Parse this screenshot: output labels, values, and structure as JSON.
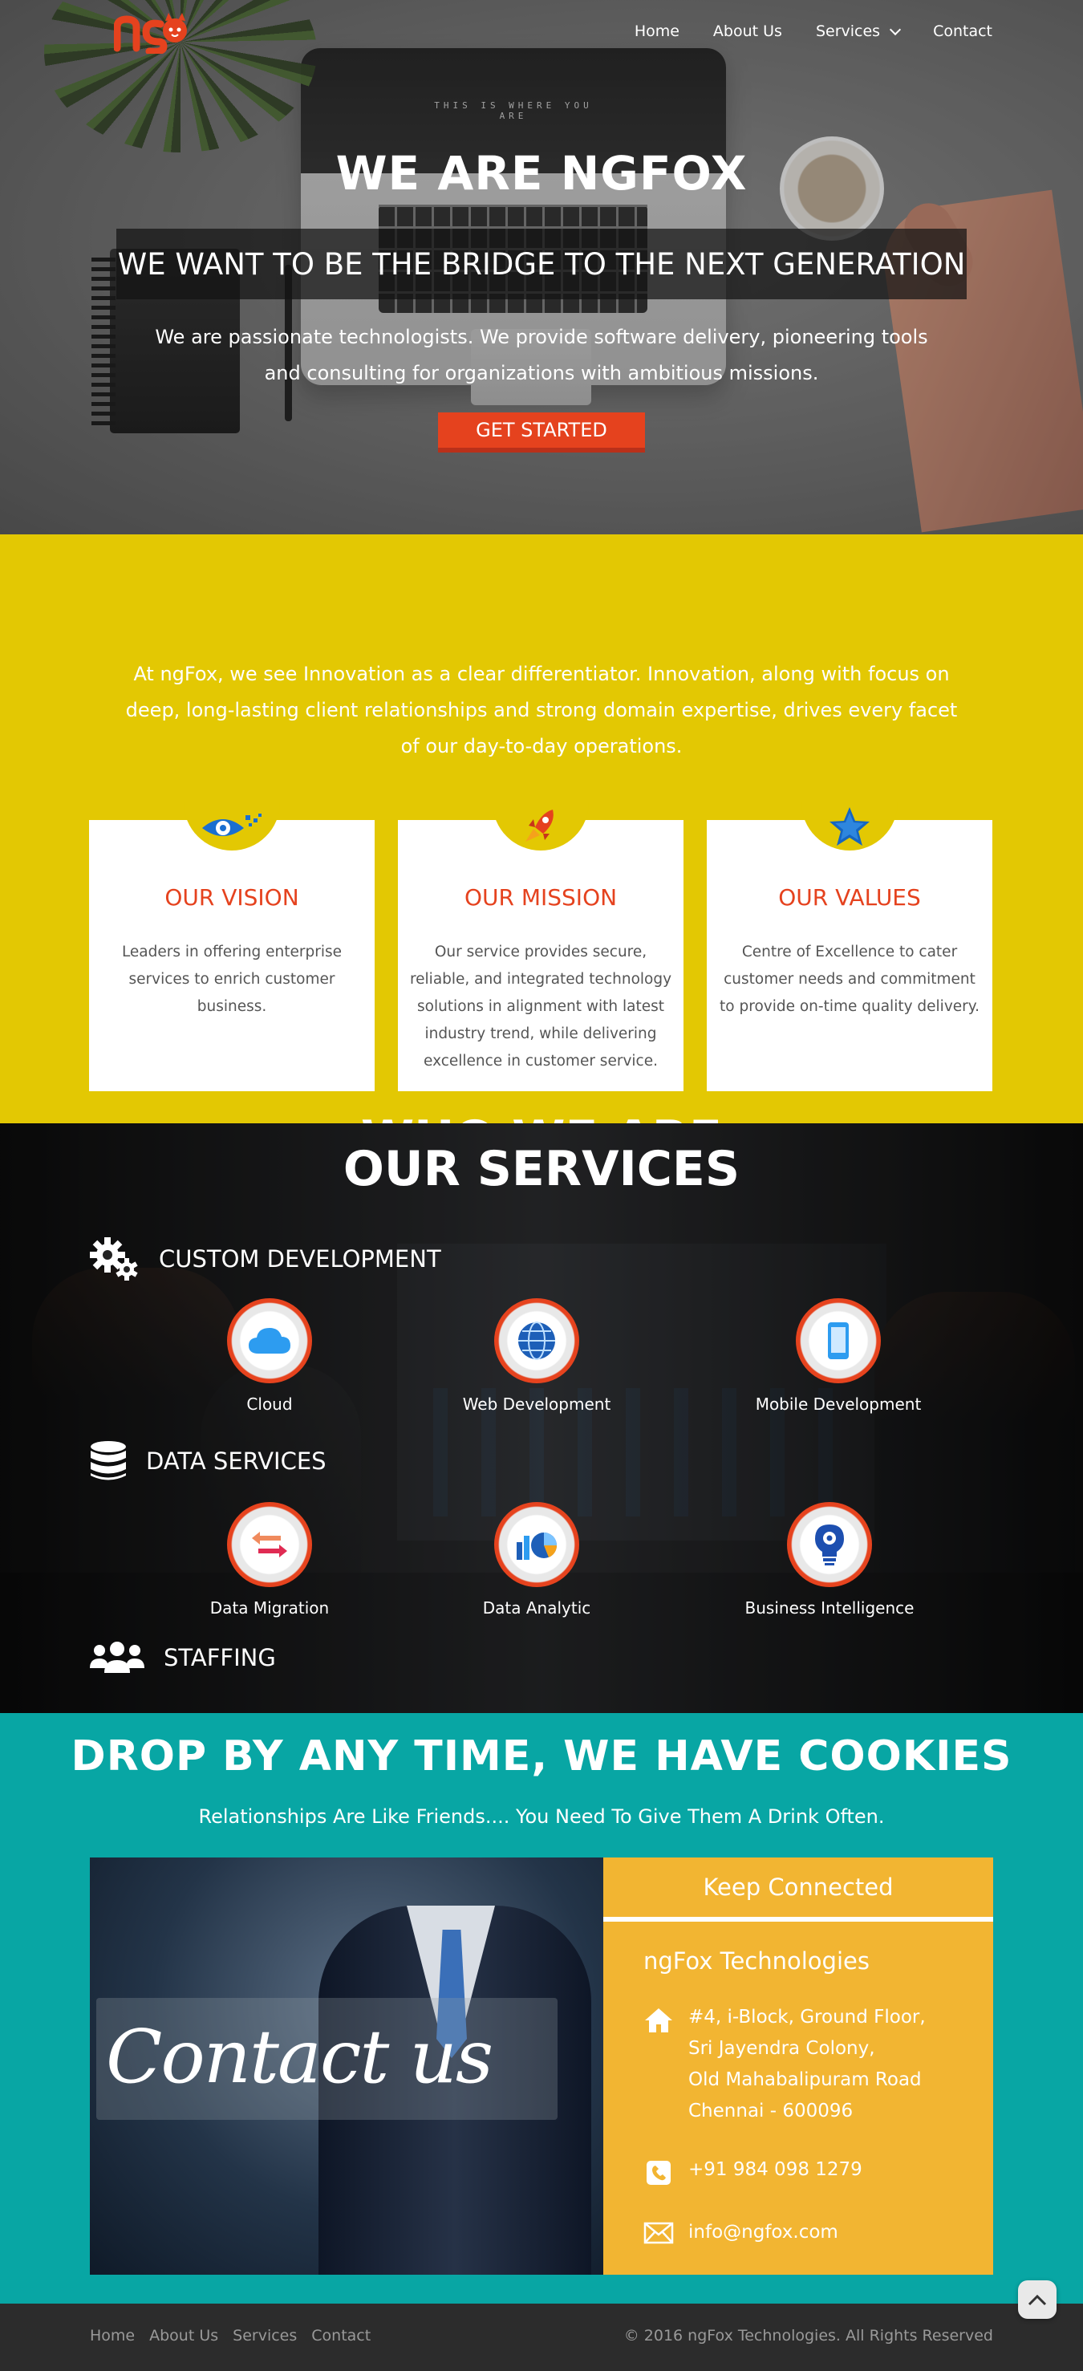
{
  "nav": {
    "logo": "ngFox",
    "items": [
      "Home",
      "About Us",
      "Services",
      "Contact"
    ]
  },
  "hero": {
    "screen_text": "THIS IS WHERE YOU ARE",
    "title": "WE ARE NGFOX",
    "tagline": "WE WANT TO BE THE BRIDGE TO THE NEXT GENERATION",
    "description": "We are passionate technologists. We provide software delivery, pioneering tools and consulting for organizations with ambitious missions.",
    "cta": "GET STARTED"
  },
  "who": {
    "title": "WHO WE ARE",
    "description": "At ngFox, we see Innovation as a clear differentiator. Innovation, along with focus on deep, long-lasting client relationships and strong domain expertise, drives every facet of our day-to-day operations.",
    "cards": [
      {
        "icon": "eye-icon",
        "title": "OUR VISION",
        "text": "Leaders in offering enterprise services to enrich customer business."
      },
      {
        "icon": "rocket-icon",
        "title": "OUR MISSION",
        "text": "Our service provides secure, reliable, and integrated technology solutions in alignment with latest industry trend, while delivering excellence in customer service."
      },
      {
        "icon": "star-icon",
        "title": "OUR VALUES",
        "text": "Centre of Excellence to cater customer needs and commitment to provide on-time quality delivery."
      }
    ]
  },
  "services": {
    "title": "OUR SERVICES",
    "categories": [
      {
        "icon": "gears-icon",
        "name": "CUSTOM DEVELOPMENT",
        "items": [
          {
            "icon": "cloud-icon",
            "label": "Cloud"
          },
          {
            "icon": "globe-icon",
            "label": "Web Development"
          },
          {
            "icon": "mobile-icon",
            "label": "Mobile Development"
          }
        ]
      },
      {
        "icon": "database-icon",
        "name": "DATA SERVICES",
        "items": [
          {
            "icon": "migration-arrows-icon",
            "label": "Data Migration"
          },
          {
            "icon": "analytics-chart-icon",
            "label": "Data Analytic"
          },
          {
            "icon": "bulb-gear-icon",
            "label": "Business Intelligence"
          }
        ]
      },
      {
        "icon": "people-icon",
        "name": "STAFFING",
        "items": []
      }
    ]
  },
  "contact": {
    "title": "DROP BY ANY TIME, WE HAVE COOKIES",
    "subtitle": "Relationships Are Like Friends.... You Need To Give Them A Drink Often.",
    "image_text": "Contact us",
    "panel_title": "Keep Connected",
    "company": "ngFox Technologies",
    "address": [
      "#4, i-Block, Ground Floor,",
      "Sri Jayendra Colony,",
      "Old Mahabalipuram Road",
      "Chennai - 600096"
    ],
    "phone": "+91 984 098 1279",
    "email": "info@ngfox.com"
  },
  "footer": {
    "links": [
      "Home",
      "About Us",
      "Services",
      "Contact"
    ],
    "copyright": "© 2016 ngFox Technologies. All Rights Reserved"
  },
  "colors": {
    "accent": "#e5421e",
    "yellow": "#e3c803",
    "teal": "#08a6a4",
    "panel": "#f2b532",
    "footer": "#2c2c2c"
  }
}
